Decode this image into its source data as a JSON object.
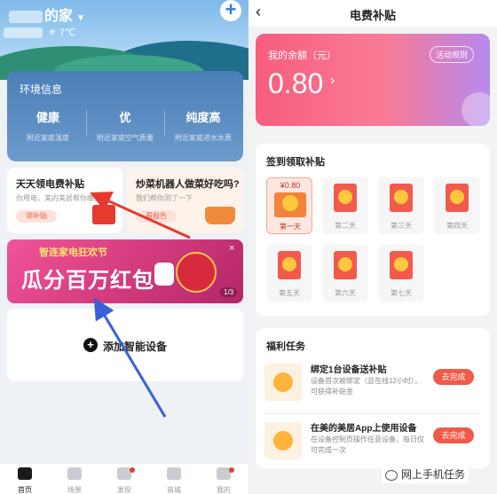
{
  "left": {
    "home_title": "的家",
    "weather_temp": "7℃",
    "env": {
      "title": "环境信息",
      "items": [
        {
          "value": "健康",
          "desc": "附近家庭湿度"
        },
        {
          "value": "优",
          "desc": "附近家庭空气质量"
        },
        {
          "value": "纯度高",
          "desc": "附近家庭进水水质"
        }
      ]
    },
    "tips": [
      {
        "title": "天天领电费补贴",
        "sub": "你用电，美的美居帮你缴费",
        "btn": "领补贴"
      },
      {
        "title": "炒菜机器人做菜好吃吗?",
        "sub": "我们帮你测了一下",
        "btn": "看报告"
      }
    ],
    "banner": {
      "top": "智连家电狂欢节",
      "main": "瓜分百万红包",
      "page": "1/3",
      "close": "×"
    },
    "add_device": "添加智能设备",
    "tabs": [
      {
        "label": "首页"
      },
      {
        "label": "场景"
      },
      {
        "label": "发现"
      },
      {
        "label": "商城"
      },
      {
        "label": "我的"
      }
    ]
  },
  "right": {
    "nav_title": "电费补贴",
    "balance": {
      "label": "我的余额（元）",
      "value": "0.80",
      "rules": "活动规则"
    },
    "signin": {
      "title": "签到领取补贴",
      "first_amount": "¥0.80",
      "days": [
        "第一天",
        "第二天",
        "第三天",
        "第四天",
        "第五天",
        "第六天",
        "第七天"
      ]
    },
    "welfare": {
      "title": "福利任务",
      "tasks": [
        {
          "title": "绑定1台设备送补贴",
          "desc": "设备首次被绑定（且在线12小时），可获得补贴金",
          "btn": "去完成"
        },
        {
          "title": "在美的美居App上使用设备",
          "desc": "在设备控制页操作任意设备，每日仅可完成一次",
          "btn": "去完成"
        }
      ]
    }
  },
  "watermark": "网上手机任务",
  "colors": {
    "accent_blue": "#2a7fe0",
    "accent_red": "#f05a48",
    "arrow_red": "#e8392f",
    "arrow_blue": "#3a5fd8"
  }
}
